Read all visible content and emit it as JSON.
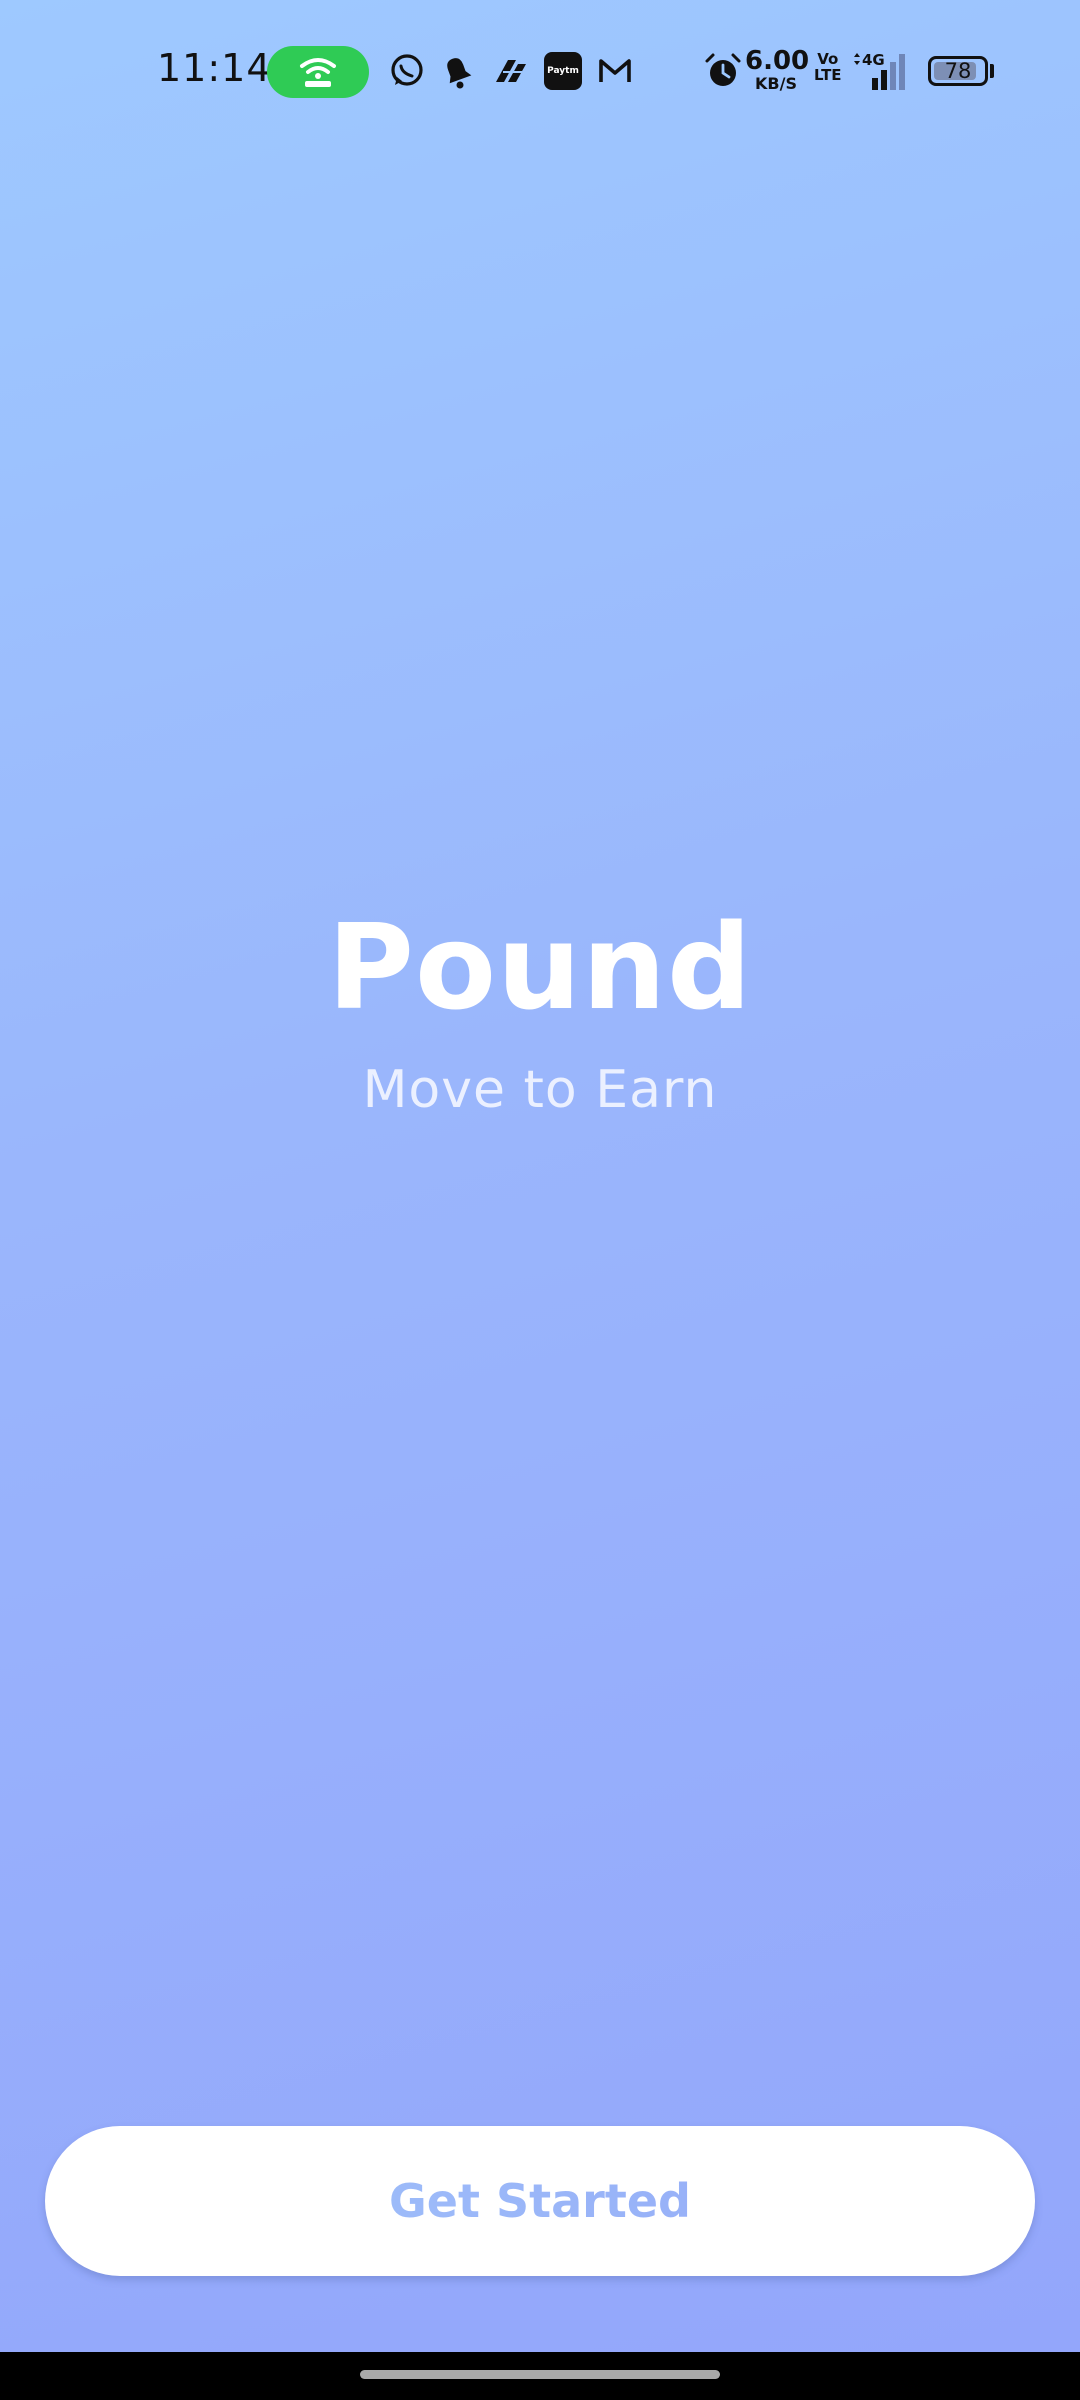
{
  "status_bar": {
    "time": "11:14",
    "hotspot_icon": "hotspot-icon",
    "notification_icons": [
      "whatsapp-icon",
      "bell-icon",
      "paper-plane-icon",
      "paytm-icon",
      "gmail-icon"
    ],
    "paytm_label": "Paytm",
    "alarm_icon": "alarm-icon",
    "network_speed_value": "6.00",
    "network_speed_unit": "KB/S",
    "volte_top": "Vo",
    "volte_bottom": "LTE",
    "network_type": "4G",
    "battery_level": "78",
    "colors": {
      "hotspot_pill": "#2fcb55"
    }
  },
  "hero": {
    "title": "Pound",
    "tagline": "Move to Earn"
  },
  "cta": {
    "label": "Get Started"
  },
  "theme": {
    "background_top": "#9ec9ff",
    "background_bottom": "#93a6fb",
    "button_bg": "#ffffff",
    "button_text_gradient": [
      "#a2c6fb",
      "#92a6f6"
    ]
  }
}
